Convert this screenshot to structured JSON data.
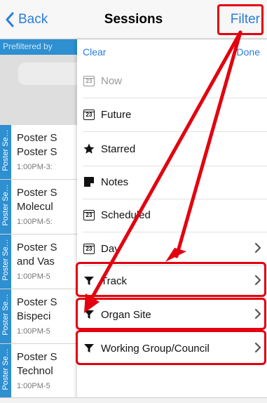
{
  "navbar": {
    "back_label": "Back",
    "title": "Sessions",
    "filter_label": "Filter"
  },
  "list": {
    "prefilter_text": "Prefiltered by",
    "rows": [
      {
        "category": "Poster Se…",
        "line1": "Poster S",
        "line2": "Poster S",
        "time": "1:00PM-3:"
      },
      {
        "category": "Poster Se…",
        "line1": "Poster S",
        "line2": "Molecul",
        "time": "1:00PM-5:"
      },
      {
        "category": "Poster Se…",
        "line1": "Poster S",
        "line2": "and Vas",
        "time": "1:00PM-5"
      },
      {
        "category": "Poster Se…",
        "line1": "Poster S",
        "line2": "Bispeci",
        "time": "1:00PM-5"
      },
      {
        "category": "Poster Se…",
        "line1": "Poster S",
        "line2": "Technol",
        "time": "1:00PM-5"
      }
    ]
  },
  "filter_panel": {
    "clear_label": "Clear",
    "done_label": "Done",
    "options": [
      {
        "label": "Now",
        "icon": "calendar-icon",
        "calendar_day": "23",
        "disabled": true,
        "chevron": false
      },
      {
        "label": "Future",
        "icon": "calendar-icon",
        "calendar_day": "23",
        "disabled": false,
        "chevron": false
      },
      {
        "label": "Starred",
        "icon": "star-icon",
        "disabled": false,
        "chevron": false
      },
      {
        "label": "Notes",
        "icon": "note-icon",
        "disabled": false,
        "chevron": false
      },
      {
        "label": "Scheduled",
        "icon": "calendar-icon",
        "calendar_day": "23",
        "disabled": false,
        "chevron": false
      },
      {
        "label": "Day",
        "icon": "calendar-icon",
        "calendar_day": "23",
        "disabled": false,
        "chevron": true
      },
      {
        "label": "Track",
        "icon": "funnel-icon",
        "disabled": false,
        "chevron": true,
        "highlighted": true
      },
      {
        "label": "Organ Site",
        "icon": "funnel-icon",
        "disabled": false,
        "chevron": true,
        "highlighted": true
      },
      {
        "label": "Working Group/Council",
        "icon": "funnel-icon",
        "disabled": false,
        "chevron": true,
        "highlighted": true
      }
    ]
  },
  "colors": {
    "accent": "#2a7ddb",
    "annotation": "#e3000f",
    "category_strip": "#2e8fd1"
  }
}
